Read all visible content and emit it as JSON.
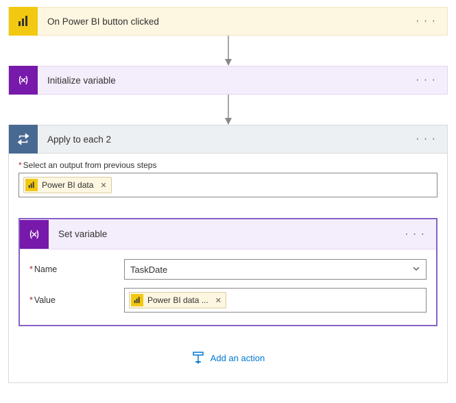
{
  "steps": {
    "trigger": {
      "title": "On Power BI button clicked"
    },
    "init": {
      "title": "Initialize variable"
    },
    "loop": {
      "title": "Apply to each 2",
      "output_label": "Select an output from previous steps",
      "output_token": "Power BI data"
    },
    "set": {
      "title": "Set variable",
      "name_label": "Name",
      "name_value": "TaskDate",
      "value_label": "Value",
      "value_token": "Power BI data ..."
    }
  },
  "add_action_label": "Add an action"
}
